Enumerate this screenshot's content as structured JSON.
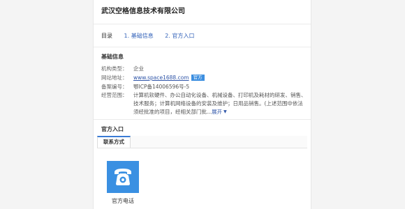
{
  "company": {
    "name": "武汉空格信息技术有限公司"
  },
  "toc": {
    "label": "目录",
    "items": [
      {
        "label": "1. 基础信息"
      },
      {
        "label": "2. 官方入口"
      }
    ]
  },
  "basic_info": {
    "heading": "基础信息",
    "org_type": {
      "key": "机构类型：",
      "value": "企业"
    },
    "website": {
      "key": "网站地址：",
      "value": "www.space1688.com",
      "badge": "官方"
    },
    "icp": {
      "key": "备案编号：",
      "value": "鄂ICP备14006596号-5"
    },
    "scope": {
      "key": "经营范围：",
      "value": "计算机软硬件、办公自动化设备、机械设备、打印机及耗材的研发、销售、技术服务；计算机网络设备的安装及维护；日用品销售。(上述范围中依法须经批准的项目，经相关部门批...",
      "expand": "展开"
    }
  },
  "official": {
    "heading": "官方入口",
    "tab": "联系方式",
    "phone_label": "官方电话"
  },
  "colors": {
    "accent": "#3a90e2",
    "link": "#2f55a8",
    "badge": "#3d8fe0"
  },
  "icons": {
    "phone": "phone-icon",
    "expand": "caret-down-icon"
  }
}
